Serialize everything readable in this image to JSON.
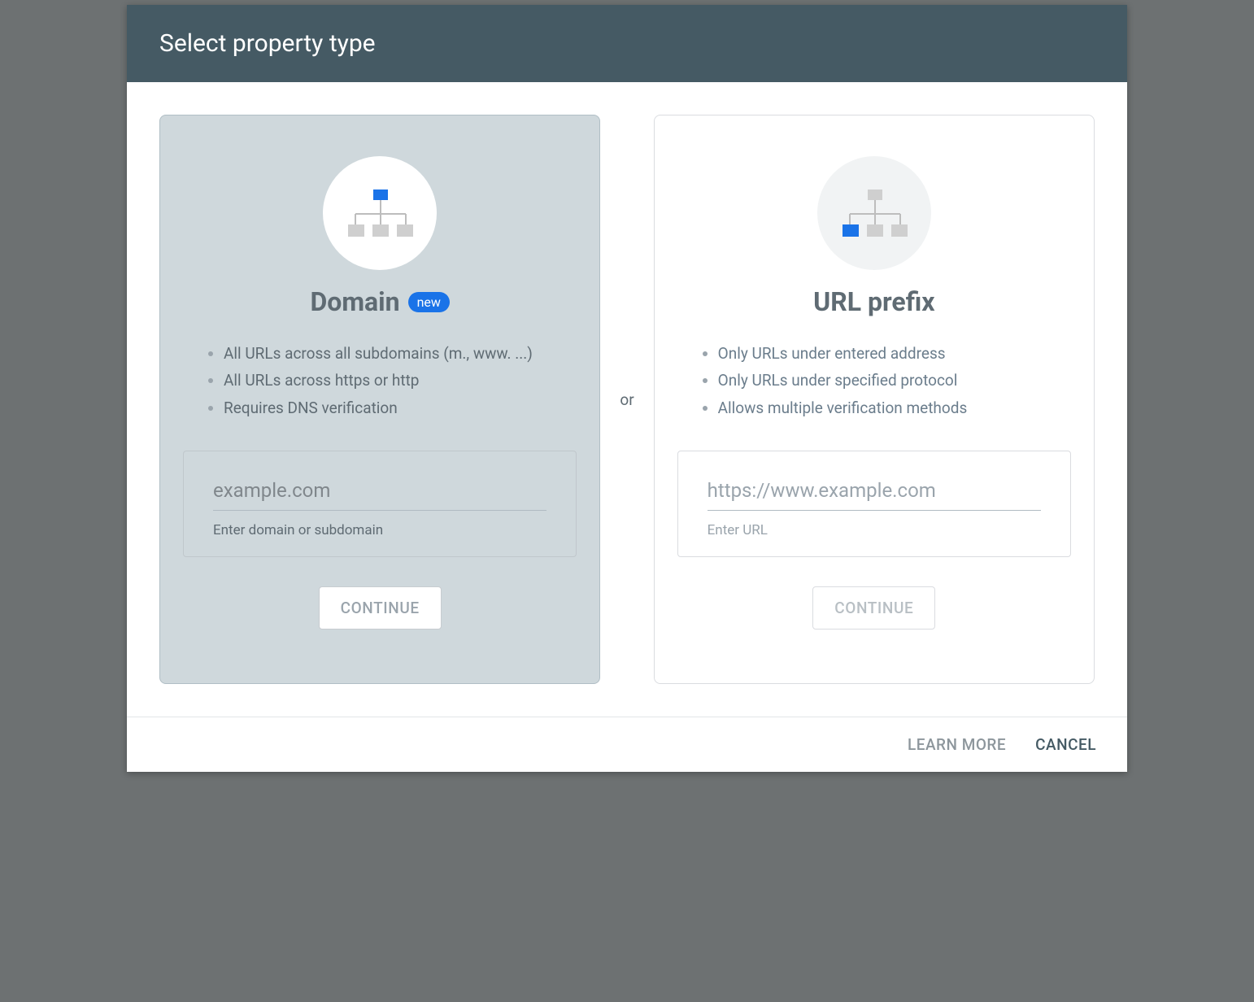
{
  "header": {
    "title": "Select property type"
  },
  "separator": "or",
  "cards": {
    "domain": {
      "title": "Domain",
      "badge": "new",
      "features": [
        "All URLs across all subdomains (m., www. ...)",
        "All URLs across https or http",
        "Requires DNS verification"
      ],
      "input_placeholder": "example.com",
      "input_helper": "Enter domain or subdomain",
      "continue_label": "CONTINUE"
    },
    "url_prefix": {
      "title": "URL prefix",
      "features": [
        "Only URLs under entered address",
        "Only URLs under specified protocol",
        "Allows multiple verification methods"
      ],
      "input_placeholder": "https://www.example.com",
      "input_helper": "Enter URL",
      "continue_label": "CONTINUE"
    }
  },
  "footer": {
    "learn_more": "LEARN MORE",
    "cancel": "CANCEL"
  },
  "colors": {
    "accent": "#1a73e8",
    "header_bg": "#455a64",
    "selected_bg": "#cfd8dc"
  }
}
